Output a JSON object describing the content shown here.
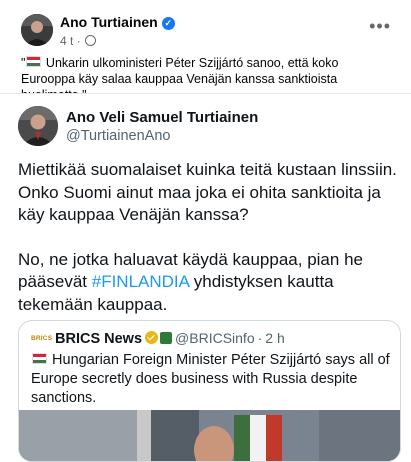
{
  "post": {
    "author": "Ano Turtiainen",
    "time": "4 t",
    "separator": "·",
    "more": "•••",
    "text_open": "\"",
    "text": "Unkarin ulkoministeri Péter Szijjártó sanoo, että koko Eurooppa käy salaa kauppaa Venäjän kanssa sanktioista huolimatta.\""
  },
  "tweet": {
    "name": "Ano Veli Samuel Turtiainen",
    "handle": "@TurtiainenAno",
    "para1": "Miettikää suomalaiset kuinka teitä kustaan linssiin. Onko Suomi ainut maa joka ei ohita sanktioita ja käy kauppaa Venäjän kanssa?",
    "para2_before": "No, ne jotka haluavat käydä kauppaa, pian he pääsevät ",
    "hashtag": "#FINLANDIA",
    "para2_after": " yhdistyksen kautta tekemään kauppaa."
  },
  "quote": {
    "logo": "BRICS",
    "name": "BRICS News",
    "handle": "@BRICSinfo",
    "time": "2 h",
    "separator": "·",
    "text": "Hungarian Foreign Minister Péter Szijjártó says all of Europe secretly does business with Russia despite sanctions."
  },
  "colors": {
    "link": "#1d9bf0",
    "fb_verified": "#1877f2",
    "brics_badge": "#e8b818"
  }
}
